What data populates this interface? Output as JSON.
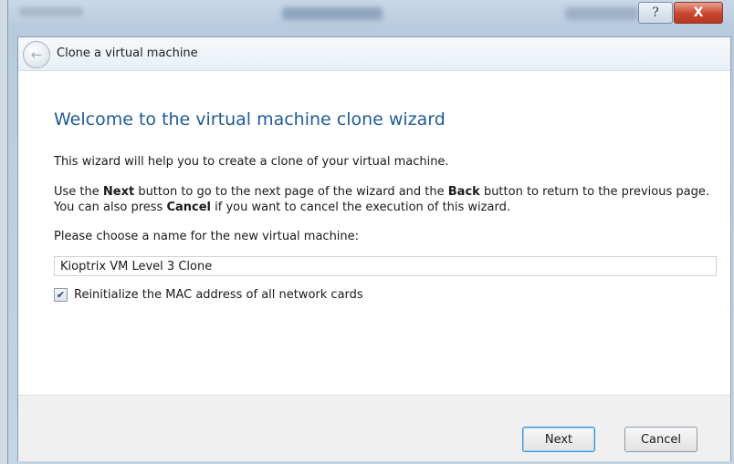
{
  "window": {
    "help_glyph": "?",
    "close_glyph": "X",
    "title": "Clone a virtual machine"
  },
  "content": {
    "heading": "Welcome to the virtual machine clone wizard",
    "intro": "This wizard will help you to create a clone of your virtual machine.",
    "instruction_parts": {
      "a": "Use the ",
      "next": "Next",
      "b": " button to go to the next page of the wizard and the ",
      "back": "Back",
      "c": " button to return to the previous page. You can also press ",
      "cancel": "Cancel",
      "d": " if you want to cancel the execution of this wizard."
    },
    "name_label": "Please choose a name for the new virtual machine:",
    "name_value": "Kioptrix VM Level 3 Clone",
    "reinit_mac_label": "Reinitialize the MAC address of all network cards",
    "reinit_mac_checked": true
  },
  "footer": {
    "next_label": "Next",
    "cancel_label": "Cancel"
  }
}
